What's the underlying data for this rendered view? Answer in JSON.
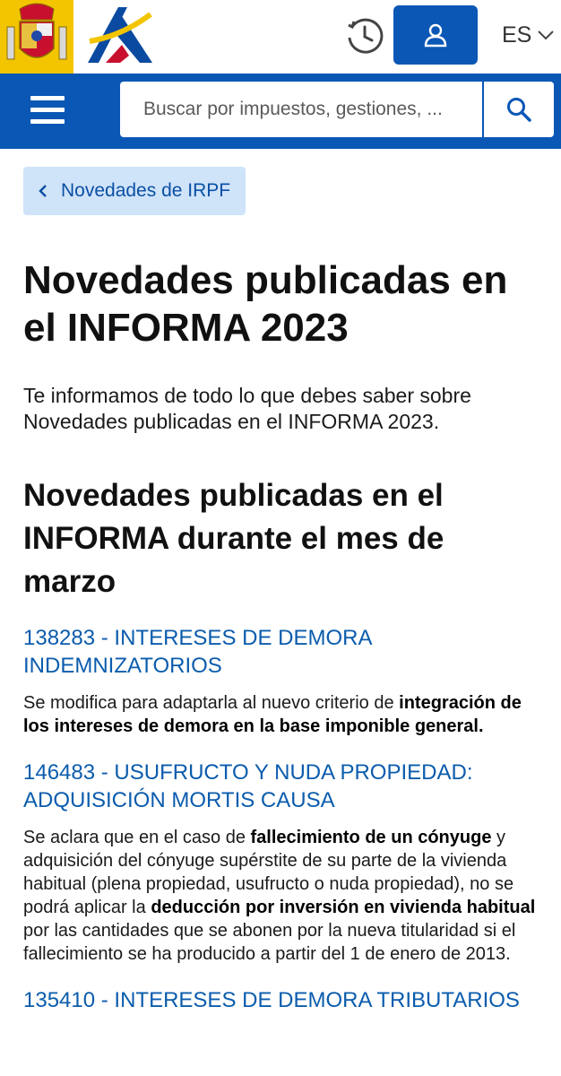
{
  "header": {
    "language": "ES"
  },
  "search": {
    "placeholder": "Buscar por impuestos, gestiones, ..."
  },
  "breadcrumb": {
    "back_label": "Novedades de IRPF"
  },
  "main": {
    "title": "Novedades publicadas en el INFORMA 2023",
    "intro": "Te informamos de todo lo que debes saber sobre Novedades publicadas en el INFORMA 2023.",
    "section_title": "Novedades publicadas en el INFORMA durante el mes de marzo",
    "items": [
      {
        "title": "138283 - INTERESES DE DEMORA INDEMNIZATORIOS",
        "desc": [
          {
            "t": "Se modifica para adaptarla al nuevo criterio de ",
            "b": false
          },
          {
            "t": "integración de los intereses de demora en la base imponible general.",
            "b": true
          }
        ]
      },
      {
        "title": "146483 - USUFRUCTO Y NUDA PROPIEDAD: ADQUISICIÓN MORTIS CAUSA",
        "desc": [
          {
            "t": "Se aclara que en el caso de ",
            "b": false
          },
          {
            "t": "fallecimiento de un cónyuge",
            "b": true
          },
          {
            "t": " y adquisición del cónyuge supérstite de su parte de la vivienda habitual (plena propiedad, usufructo o nuda propiedad), no se podrá aplicar la ",
            "b": false
          },
          {
            "t": "deducción por inversión en vivienda habitual",
            "b": true
          },
          {
            "t": " por las cantidades que se abonen por la nueva titularidad si el fallecimiento se ha producido a partir del 1 de enero de 2013.",
            "b": false
          }
        ]
      },
      {
        "title": "135410 - INTERESES DE DEMORA TRIBUTARIOS",
        "desc": []
      }
    ]
  },
  "icons": {
    "crest": "spain-coat-of-arms-icon",
    "logo": "agencia-tributaria-logo-icon",
    "history": "clock-history-icon",
    "user": "user-icon",
    "language": "chevron-down-icon",
    "menu": "hamburger-menu-icon",
    "search": "search-icon",
    "back": "chevron-left-icon"
  },
  "colors": {
    "brand_blue": "#0a57b5",
    "link_blue": "#0b5cad",
    "breadcrumb_bg": "#cfe3f9",
    "crest_yellow": "#f2c500",
    "logo_red": "#c8102e"
  }
}
